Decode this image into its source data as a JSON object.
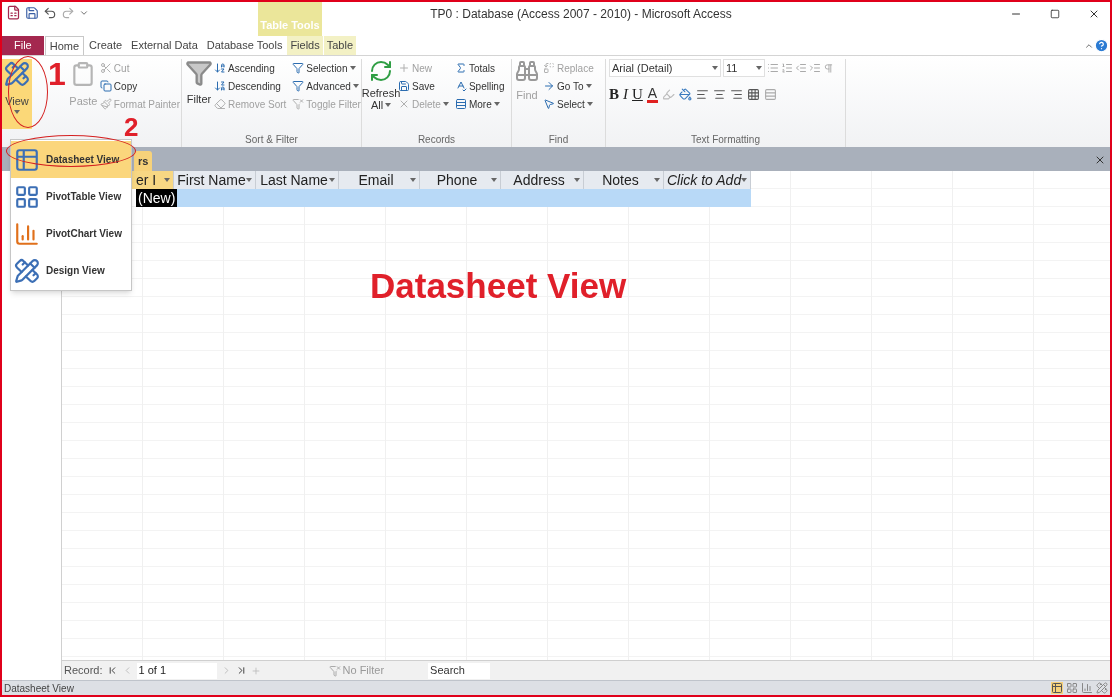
{
  "title_bar": {
    "contextual_label": "Table Tools",
    "title": "TP0 : Database (Access 2007 - 2010) - Microsoft Access"
  },
  "ribbon_tabs": [
    {
      "label": "File",
      "kind": "file",
      "selected": false
    },
    {
      "label": "Home",
      "kind": "tab",
      "selected": true
    },
    {
      "label": "Create",
      "kind": "tab",
      "selected": false
    },
    {
      "label": "External Data",
      "kind": "tab",
      "selected": false
    },
    {
      "label": "Database Tools",
      "kind": "tab",
      "selected": false
    },
    {
      "label": "Fields",
      "kind": "contextual",
      "selected": false
    },
    {
      "label": "Table",
      "kind": "contextual",
      "selected": false
    }
  ],
  "views": {
    "label": "View",
    "pressed": true
  },
  "clipboard": {
    "paste": {
      "label": "Paste",
      "disabled": true
    },
    "items": [
      {
        "label": "Cut",
        "disabled": true
      },
      {
        "label": "Copy",
        "disabled": false
      },
      {
        "label": "Format Painter",
        "disabled": true
      }
    ]
  },
  "sort_filter": {
    "label": "Sort & Filter",
    "filter": "Filter",
    "items": [
      {
        "label": "Ascending",
        "disabled": false,
        "has_menu": false
      },
      {
        "label": "Selection",
        "disabled": false,
        "has_menu": true
      },
      {
        "label": "Descending",
        "disabled": false,
        "has_menu": false
      },
      {
        "label": "Advanced",
        "disabled": false,
        "has_menu": true
      },
      {
        "label": "Remove Sort",
        "disabled": true,
        "has_menu": false
      },
      {
        "label": "Toggle Filter",
        "disabled": true,
        "has_menu": false
      }
    ]
  },
  "records": {
    "label": "Records",
    "refresh": [
      "Refresh",
      "All"
    ],
    "items": [
      {
        "label": "New",
        "disabled": true,
        "has_menu": false
      },
      {
        "label": "Totals",
        "disabled": false,
        "has_menu": false
      },
      {
        "label": "Save",
        "disabled": false,
        "has_menu": false
      },
      {
        "label": "Spelling",
        "disabled": false,
        "has_menu": false
      },
      {
        "label": "Delete",
        "disabled": true,
        "has_menu": true
      },
      {
        "label": "More",
        "disabled": false,
        "has_menu": true
      }
    ]
  },
  "find": {
    "label": "Find",
    "find_button": {
      "label": "Find",
      "disabled": true
    },
    "items": [
      {
        "label": "Replace",
        "disabled": true,
        "has_menu": false
      },
      {
        "label": "Go To",
        "disabled": false,
        "has_menu": true
      },
      {
        "label": "Select",
        "disabled": false,
        "has_menu": true
      }
    ]
  },
  "text_formatting": {
    "label": "Text Formatting",
    "font": "Arial (Detail)",
    "size": "11",
    "styles": [
      "B",
      "I",
      "U"
    ],
    "font_color": "A"
  },
  "object_tab": {
    "label": "rs"
  },
  "columns": [
    "er I",
    "First Name",
    "Last Name",
    "Email",
    "Phone",
    "Address",
    "Notes",
    "Click to Add"
  ],
  "new_row": {
    "label": "(New)"
  },
  "view_menu": [
    {
      "label": "Datasheet View",
      "selected": true
    },
    {
      "label": "PivotTable View",
      "selected": false
    },
    {
      "label": "PivotChart View",
      "selected": false
    },
    {
      "label": "Design View",
      "selected": false
    }
  ],
  "record_nav": {
    "label": "Record:",
    "position": "1 of 1",
    "filter": "No Filter",
    "search_placeholder": "Search"
  },
  "status_bar": {
    "text": "Datasheet View"
  },
  "annotations": {
    "step_1": "1",
    "step_2": "2",
    "caption": "Datasheet View"
  }
}
